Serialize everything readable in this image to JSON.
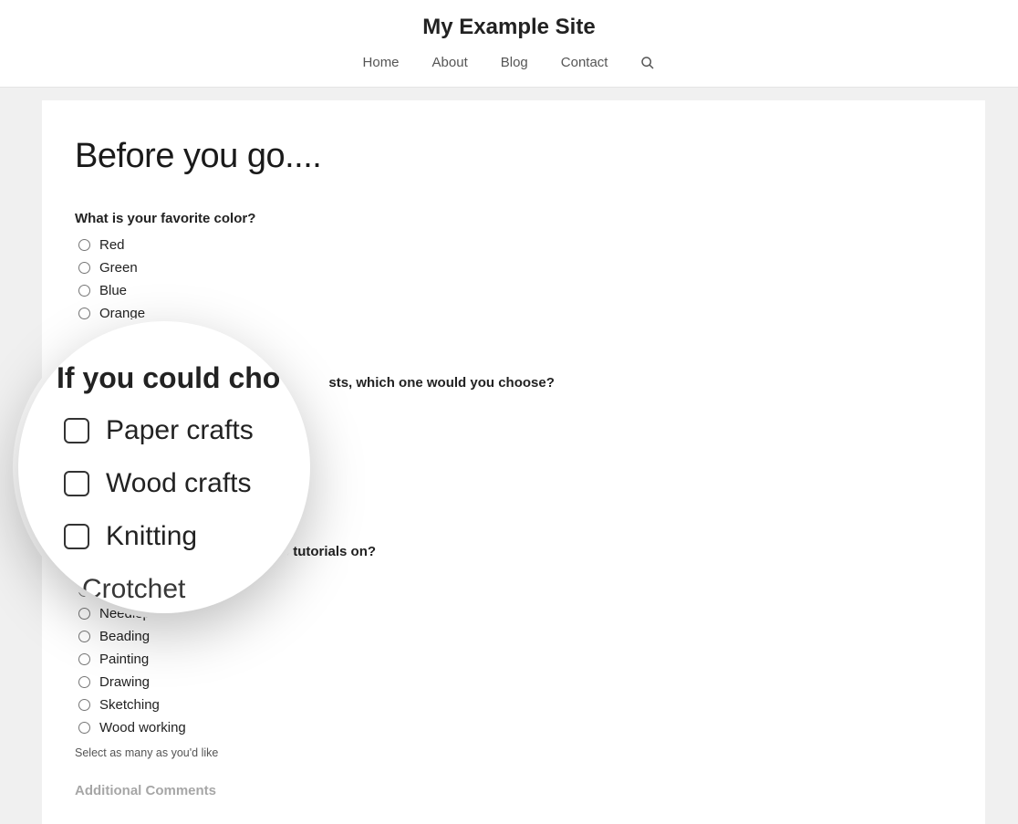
{
  "header": {
    "site_title": "My Example Site",
    "nav": [
      "Home",
      "About",
      "Blog",
      "Contact"
    ]
  },
  "page": {
    "title": "Before you go....",
    "q1": {
      "label": "What is your favorite color?",
      "options": [
        "Red",
        "Green",
        "Blue",
        "Orange"
      ]
    },
    "q2": {
      "label_partial": "sts, which one would you choose?"
    },
    "q3": {
      "label_partial": "video tutorials on?",
      "options": [
        "Crotchet",
        "Needlepoint",
        "Beading",
        "Painting",
        "Drawing",
        "Sketching",
        "Wood working"
      ],
      "hint": "Select as many as you'd like"
    },
    "additional_label": "Additional Comments"
  },
  "magnifier": {
    "heading": "If you could cho",
    "items": [
      "Paper crafts",
      "Wood crafts",
      "Knitting",
      "Crotchet"
    ]
  }
}
